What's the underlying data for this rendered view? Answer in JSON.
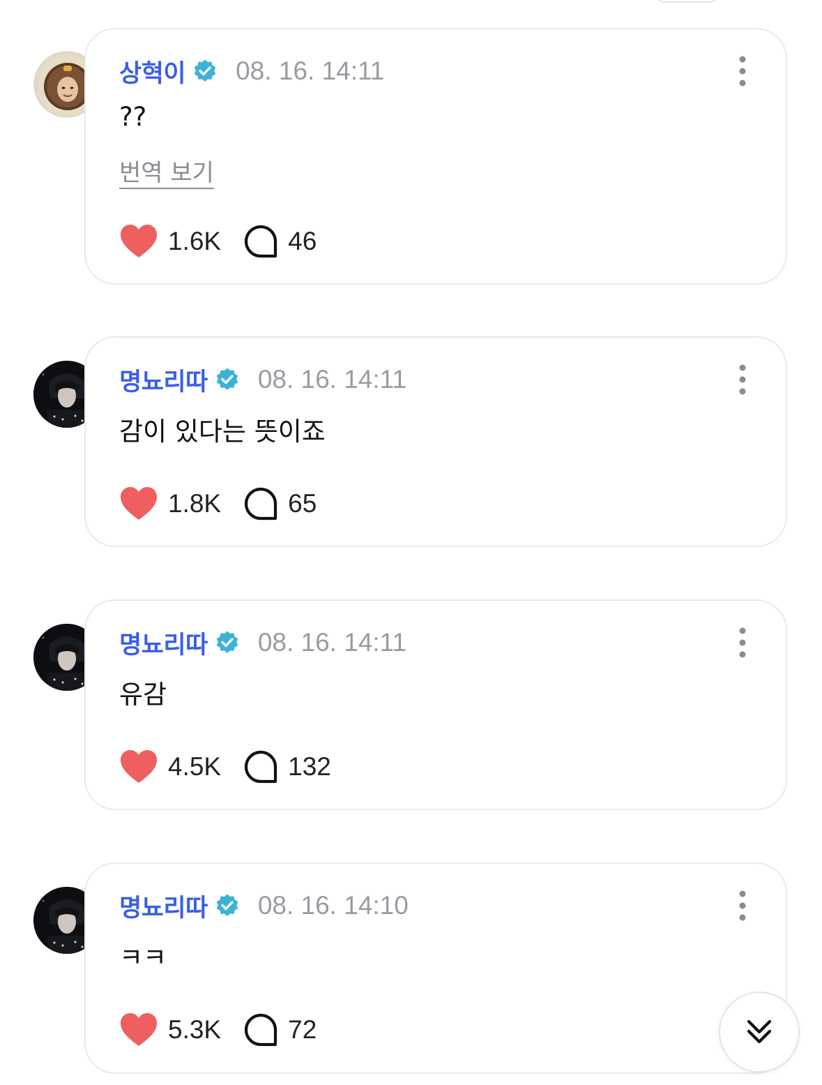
{
  "comments": [
    {
      "author": "상혁이",
      "timestamp": "08. 16. 14:11",
      "text": "??",
      "translate_label": "번역 보기",
      "likes": "1.6K",
      "replies": "46",
      "avatar_icon": "avatar-photo"
    },
    {
      "author": "명뇨리따",
      "timestamp": "08. 16. 14:11",
      "text": "감이 있다는 뜻이죠",
      "likes": "1.8K",
      "replies": "65",
      "avatar_icon": "avatar-photo"
    },
    {
      "author": "명뇨리따",
      "timestamp": "08. 16. 14:11",
      "text": "유감",
      "likes": "4.5K",
      "replies": "132",
      "avatar_icon": "avatar-photo"
    },
    {
      "author": "명뇨리따",
      "timestamp": "08. 16. 14:10",
      "text": "ㅋㅋ",
      "likes": "5.3K",
      "replies": "72",
      "avatar_icon": "avatar-photo"
    }
  ],
  "icons": {
    "verified": "verified-badge-icon",
    "more": "more-vertical-icon",
    "like": "heart-icon",
    "reply": "comment-bubble-icon",
    "scroll": "double-chevron-down-icon"
  },
  "colors": {
    "author": "#3a5ee8",
    "verified": "#3bb3d6",
    "heart": "#ef5f5f",
    "timestamp": "#9a9aa2",
    "bubble_border": "#e9e9ee"
  }
}
